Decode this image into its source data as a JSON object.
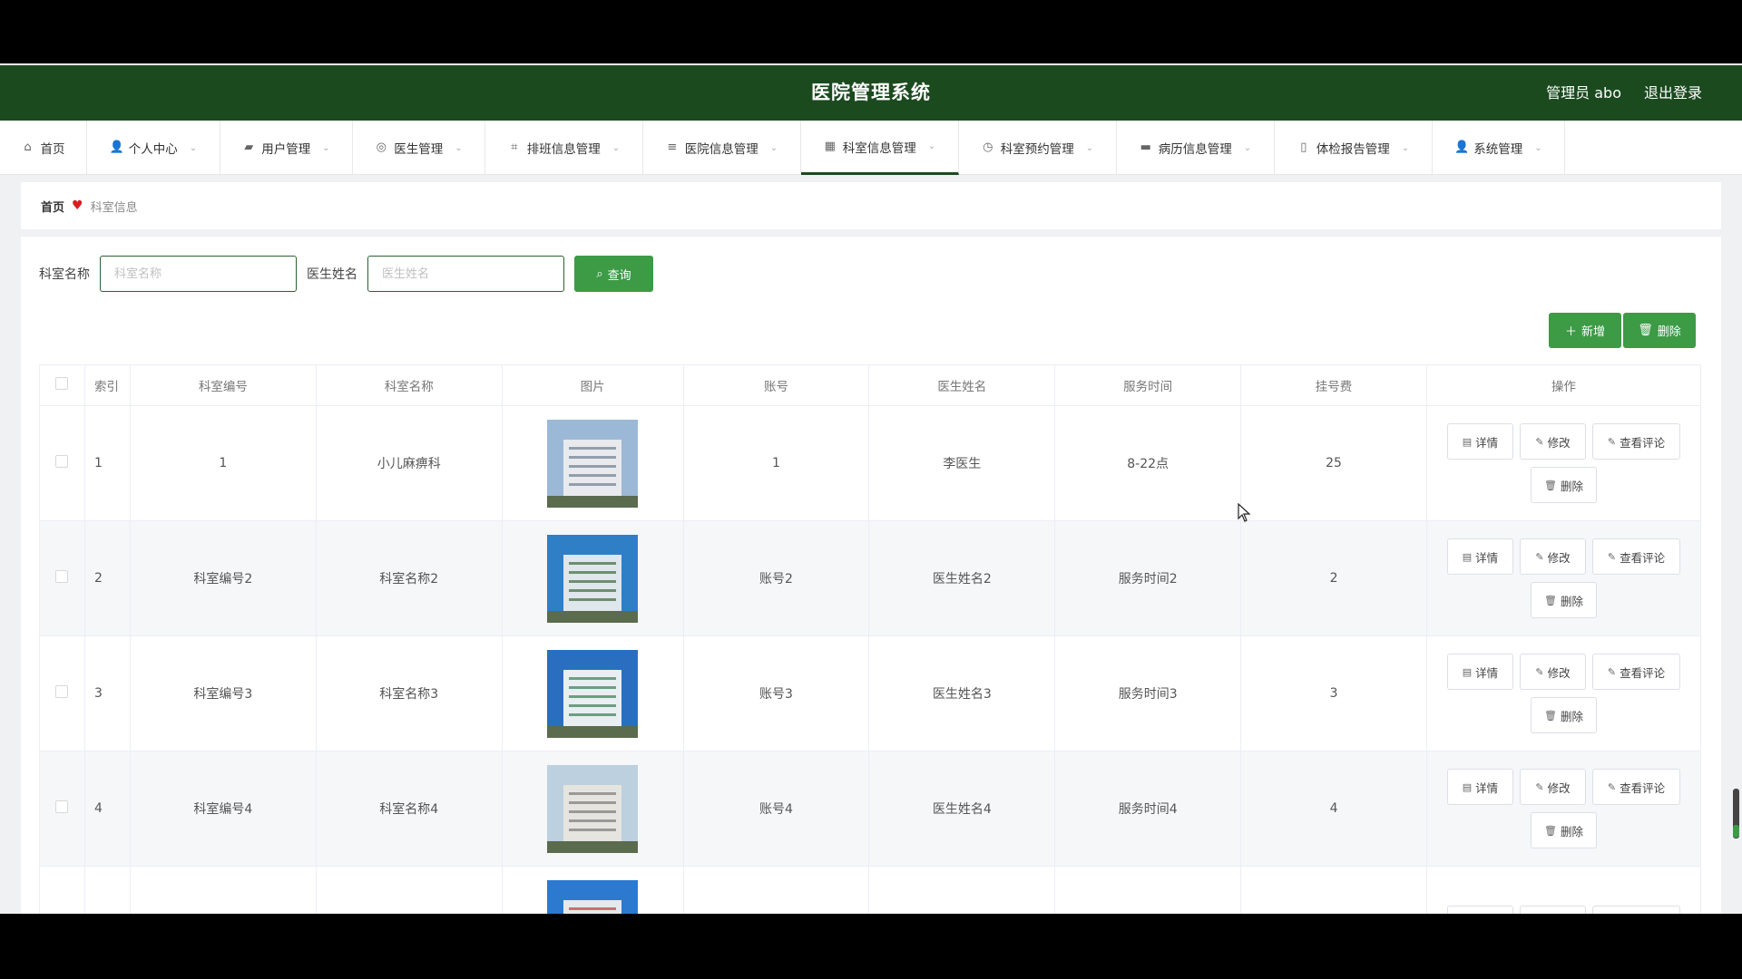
{
  "header": {
    "title": "医院管理系统",
    "admin": "管理员 abo",
    "logout": "退出登录"
  },
  "nav": [
    {
      "label": "首页",
      "icon": "home-icon",
      "glyph": "⌂",
      "width": 96,
      "chevron": false
    },
    {
      "label": "个人中心",
      "icon": "user-icon",
      "glyph": "👤",
      "width": 147,
      "chevron": true
    },
    {
      "label": "用户管理",
      "icon": "users-icon",
      "glyph": "▰",
      "width": 146,
      "chevron": true
    },
    {
      "label": "医生管理",
      "icon": "doctor-icon",
      "glyph": "◎",
      "width": 146,
      "chevron": true
    },
    {
      "label": "排班信息管理",
      "icon": "schedule-icon",
      "glyph": "⌗",
      "width": 174,
      "chevron": true
    },
    {
      "label": "医院信息管理",
      "icon": "sliders-icon",
      "glyph": "≡",
      "width": 174,
      "chevron": true
    },
    {
      "label": "科室信息管理",
      "icon": "grid-icon",
      "glyph": "▦",
      "width": 174,
      "chevron": true,
      "active": true
    },
    {
      "label": "科室预约管理",
      "icon": "clock-icon",
      "glyph": "◷",
      "width": 174,
      "chevron": true
    },
    {
      "label": "病历信息管理",
      "icon": "record-icon",
      "glyph": "▬",
      "width": 174,
      "chevron": true
    },
    {
      "label": "体检报告管理",
      "icon": "report-icon",
      "glyph": "▯",
      "width": 174,
      "chevron": true
    },
    {
      "label": "系统管理",
      "icon": "settings-icon",
      "glyph": "👤",
      "width": 146,
      "chevron": true
    }
  ],
  "breadcrumb": {
    "home": "首页",
    "current": "科室信息"
  },
  "search": {
    "dept_label": "科室名称",
    "dept_placeholder": "科室名称",
    "doctor_label": "医生姓名",
    "doctor_placeholder": "医生姓名",
    "query_label": "查询"
  },
  "toolbar": {
    "add_label": "新增",
    "delete_label": "删除"
  },
  "table": {
    "headers": [
      "索引",
      "科室编号",
      "科室名称",
      "图片",
      "账号",
      "医生姓名",
      "服务时间",
      "挂号费",
      "操作"
    ],
    "ops": {
      "detail": "详情",
      "edit": "修改",
      "review": "查看评论",
      "delete": "删除"
    },
    "rows": [
      {
        "index": "1",
        "code": "1",
        "name": "小儿麻痹科",
        "account": "1",
        "doctor": "李医生",
        "time": "8-22点",
        "fee": "25",
        "img": "a"
      },
      {
        "index": "2",
        "code": "科室编号2",
        "name": "科室名称2",
        "account": "账号2",
        "doctor": "医生姓名2",
        "time": "服务时间2",
        "fee": "2",
        "img": "b"
      },
      {
        "index": "3",
        "code": "科室编号3",
        "name": "科室名称3",
        "account": "账号3",
        "doctor": "医生姓名3",
        "time": "服务时间3",
        "fee": "3",
        "img": "c"
      },
      {
        "index": "4",
        "code": "科室编号4",
        "name": "科室名称4",
        "account": "账号4",
        "doctor": "医生姓名4",
        "time": "服务时间4",
        "fee": "4",
        "img": "d"
      },
      {
        "index": "",
        "code": "",
        "name": "",
        "account": "",
        "doctor": "",
        "time": "",
        "fee": "",
        "img": "e"
      }
    ]
  }
}
